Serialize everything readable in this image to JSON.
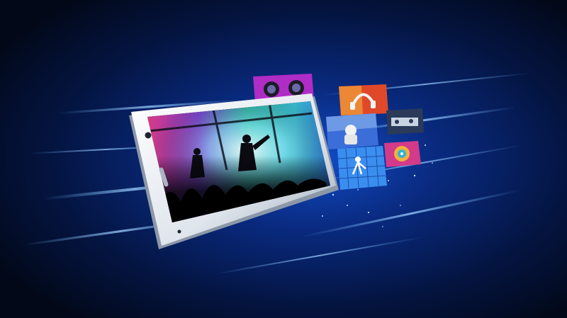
{
  "image": {
    "kind": "promotional-render",
    "subject": "smartphone-with-media-tiles",
    "palette": {
      "background_dark": "#020818",
      "background_glow": "#0b3fb0",
      "light_streak": "#6fb6ff",
      "phone_frame": "#e9eef4",
      "phone_frame_shadow": "#9aa6b5"
    },
    "tiles": [
      {
        "name": "tile-camera-lenses",
        "accent": "#b02cc6"
      },
      {
        "name": "tile-headphones",
        "accent": "#e0482a"
      },
      {
        "name": "tile-astronaut",
        "accent": "#3b6ed8"
      },
      {
        "name": "tile-dj-console",
        "accent": "#2b3a58"
      },
      {
        "name": "tile-dancer",
        "accent": "#3a8ef0"
      },
      {
        "name": "tile-kaleidoscope",
        "accent": "#d33a8a"
      }
    ]
  }
}
